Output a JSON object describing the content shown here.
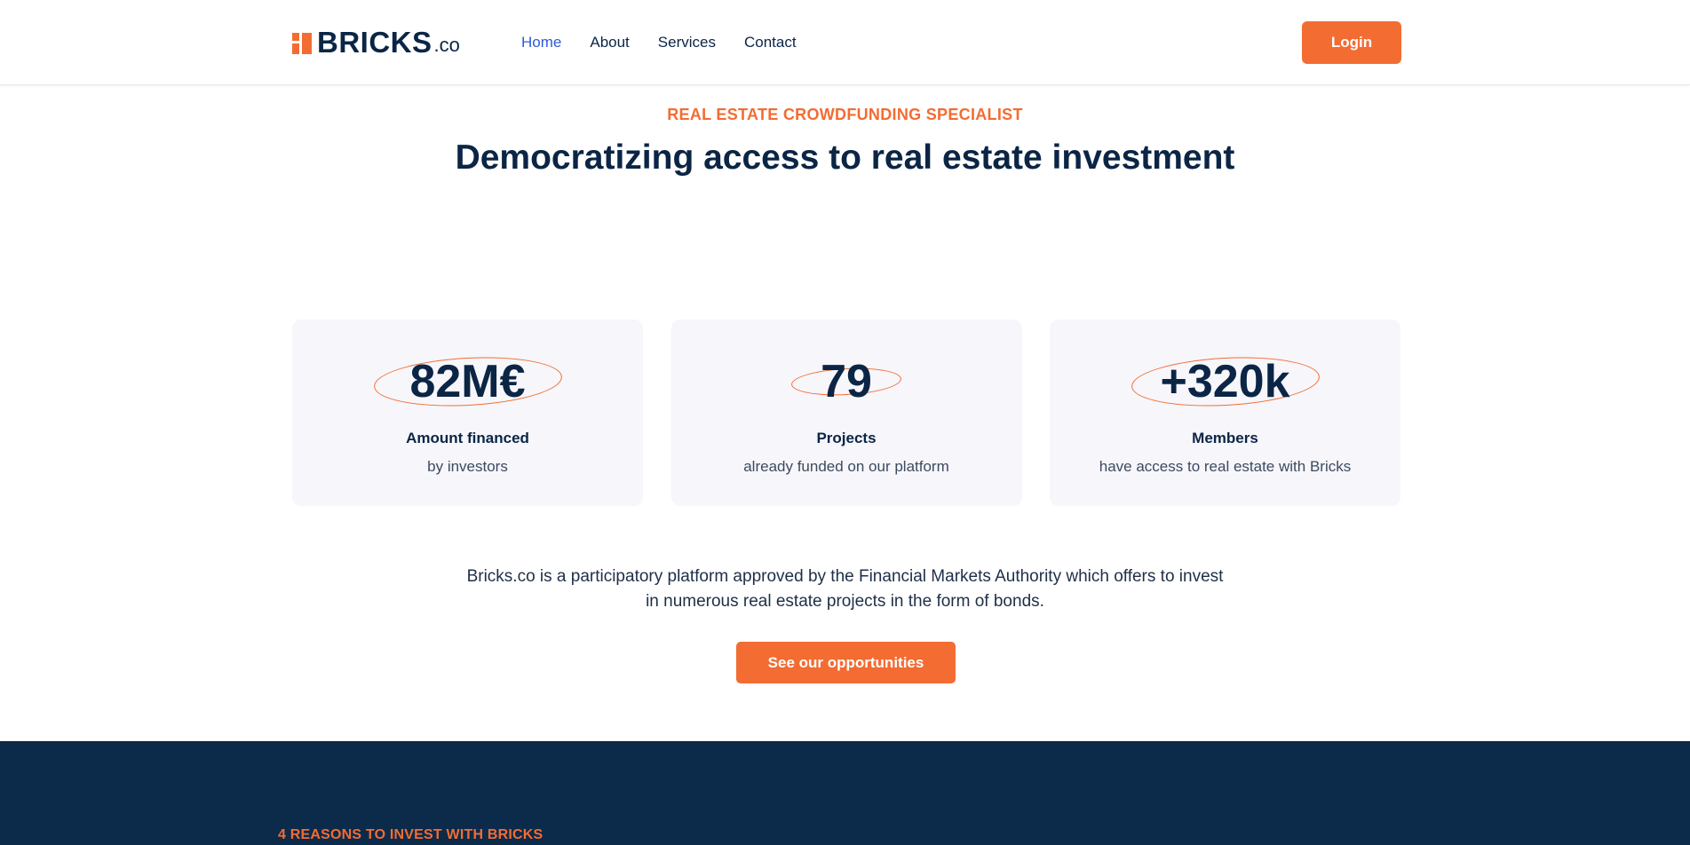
{
  "header": {
    "logo_text": "BRICKS",
    "logo_suffix": ".co",
    "nav": [
      {
        "label": "Home",
        "active": true
      },
      {
        "label": "About"
      },
      {
        "label": "Services"
      },
      {
        "label": "Contact"
      }
    ],
    "login_label": "Login"
  },
  "hero": {
    "eyebrow": "REAL ESTATE CROWDFUNDING SPECIALIST",
    "headline": "Democratizing access to real estate investment"
  },
  "stats": [
    {
      "value": "82M€",
      "label": "Amount financed",
      "sub": "by investors"
    },
    {
      "value": "79",
      "label": "Projects",
      "sub": "already funded on our platform"
    },
    {
      "value": "+320k",
      "label": "Members",
      "sub": "have access to real estate with Bricks"
    }
  ],
  "description": {
    "line1": "Bricks.co is a participatory platform approved by the Financial Markets Authority which offers to invest",
    "line2": "in numerous real estate projects in the form of bonds."
  },
  "cta_label": "See our opportunities",
  "reasons_eyebrow": "4 REASONS TO INVEST WITH BRICKS",
  "colors": {
    "accent": "#f36c32",
    "navy": "#0b2545",
    "link_active": "#2f5bd3",
    "card_bg": "#f6f6fb",
    "dark_section": "#0c2a4a"
  }
}
